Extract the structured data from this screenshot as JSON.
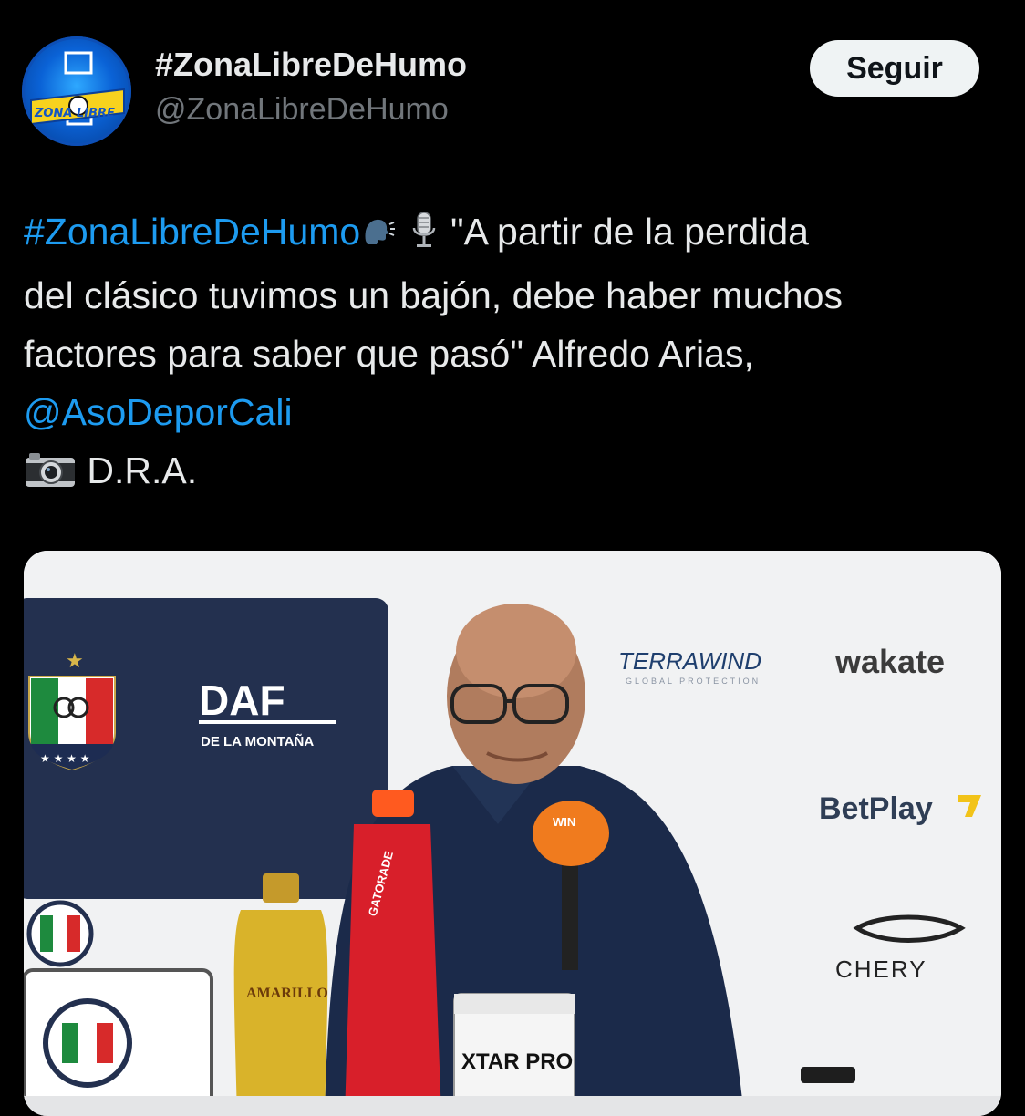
{
  "author": {
    "display_name": "#ZonaLibreDeHumo",
    "handle": "@ZonaLibreDeHumo",
    "avatar_text": "ZONA LIBRE"
  },
  "follow_button": {
    "label": "Seguir"
  },
  "tweet": {
    "hashtag": "#ZonaLibreDeHumo",
    "emoji_1": "speaking-head-icon",
    "emoji_2": "microphone-icon",
    "line1_text": "\"A partir de la perdida",
    "line2_text": "del clásico tuvimos un bajón, debe haber muchos",
    "line3_text": "factores para saber que pasó\" Alfredo Arias,",
    "mention": "@AsoDeporCali",
    "camera_emoji": "camera-icon",
    "credit": "D.R.A."
  },
  "media": {
    "sponsors": {
      "daf": "DAF",
      "daf_sub": "DE LA MONTAÑA",
      "terrawind": "TERRAWIND",
      "terrawind_sub": "GLOBAL PROTECTION",
      "wakate": "wakate",
      "betplay": "BetPlay",
      "chery": "CHERY"
    },
    "products": {
      "gatorade": "GATORADE",
      "amarillo": "AMARILLO",
      "xtar": "XTAR PRO",
      "mic_brand": "WIN"
    }
  },
  "colors": {
    "background": "#000000",
    "text": "#e7e9ea",
    "muted": "#71767b",
    "link": "#1d9bf0",
    "follow_bg": "#eff3f4"
  }
}
